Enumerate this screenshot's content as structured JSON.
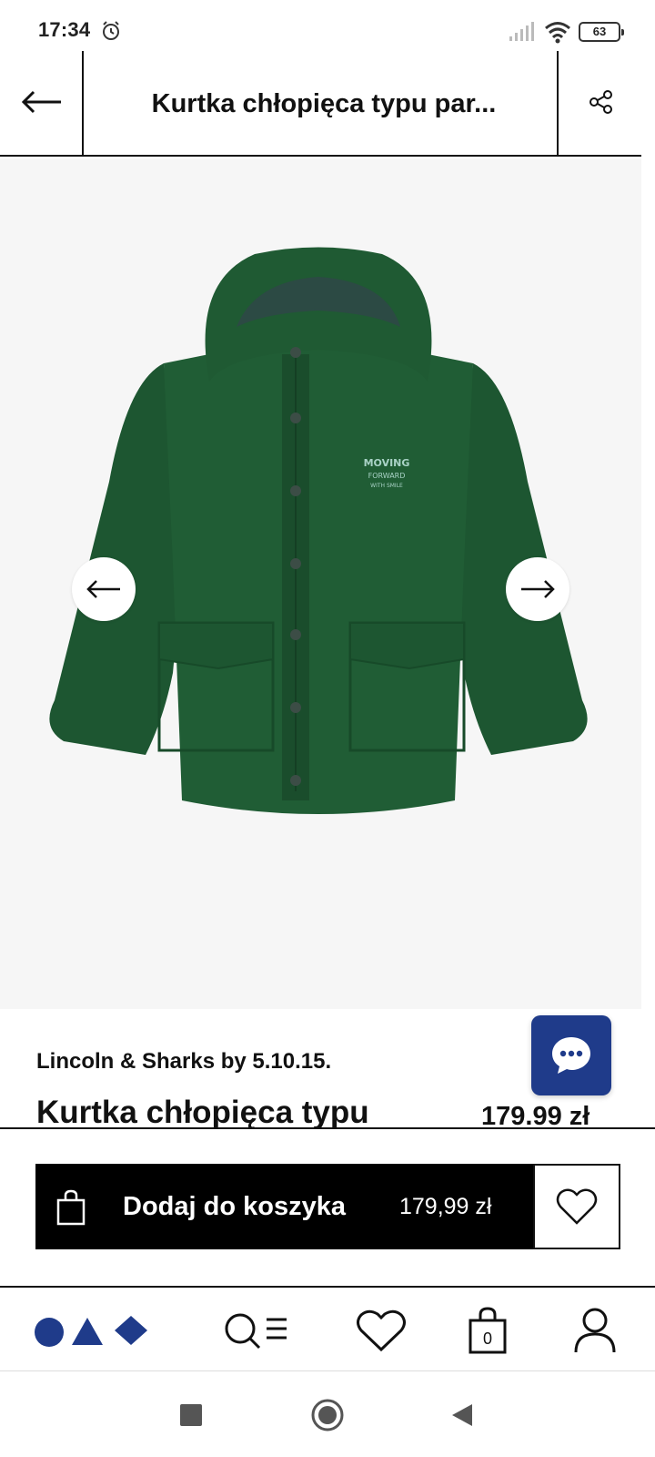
{
  "status_bar": {
    "time": "17:34",
    "battery": "63",
    "icons": [
      "alarm-icon",
      "signal-icon",
      "wifi-icon",
      "battery-icon"
    ]
  },
  "header": {
    "title": "Kurtka chłopięca typu par...",
    "back_icon": "arrow-left-icon",
    "share_icon": "share-icon"
  },
  "gallery": {
    "prev_icon": "arrow-left-icon",
    "next_icon": "arrow-right-icon",
    "jacket_print": [
      "MOVING",
      "FORWARD",
      "WITH SMILE"
    ]
  },
  "product": {
    "brand": "Lincoln & Sharks by 5.10.15.",
    "name": "Kurtka chłopięca typu",
    "price": "179.99 zł"
  },
  "cart_bar": {
    "add_label": "Dodaj do koszyka",
    "add_price": "179,99 zł",
    "bag_icon": "shopping-bag-icon",
    "wishlist_icon": "heart-icon"
  },
  "chat": {
    "icon": "chat-bubble-icon"
  },
  "bottom_nav": {
    "items": [
      {
        "icon": "brand-shapes-icon"
      },
      {
        "icon": "search-menu-icon"
      },
      {
        "icon": "heart-icon"
      },
      {
        "icon": "cart-bag-icon",
        "count": "0"
      },
      {
        "icon": "account-icon"
      }
    ]
  },
  "colors": {
    "brand_navy": "#1f3b8a",
    "jacket_green": "#1f5a33",
    "cart_black": "#000000"
  }
}
